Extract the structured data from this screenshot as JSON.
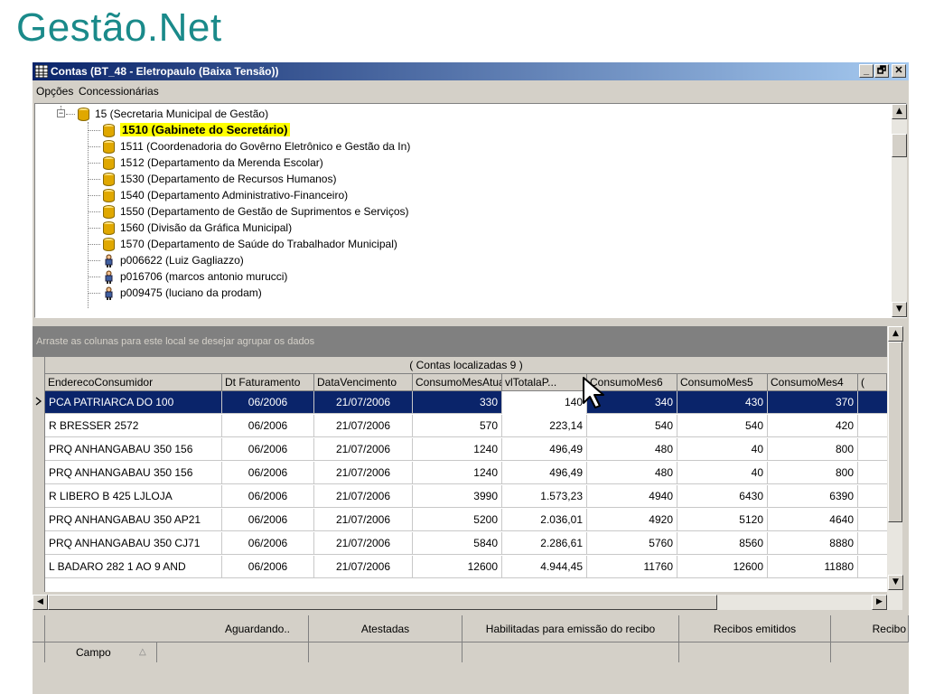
{
  "slide": {
    "title": "Gestão.Net"
  },
  "window": {
    "title": "Contas (BT_48 - Eletropaulo (Baixa Tensão))",
    "buttons": {
      "minimize": "_",
      "maximize": "🗗",
      "close": "✕"
    }
  },
  "menu": {
    "items": [
      "Opções",
      "Concessionárias"
    ]
  },
  "tree": {
    "root": "15 (Secretaria Municipal  de Gestão)",
    "children": [
      {
        "label": "1510 (Gabinete do Secretário)",
        "type": "org",
        "selected": true
      },
      {
        "label": "1511 (Coordenadoria do Govêrno Eletrônico e Gestão da In)",
        "type": "org"
      },
      {
        "label": "1512 (Departamento da Merenda Escolar)",
        "type": "org"
      },
      {
        "label": "1530 (Departamento de Recursos Humanos)",
        "type": "org"
      },
      {
        "label": "1540 (Departamento Administrativo-Financeiro)",
        "type": "org"
      },
      {
        "label": "1550 (Departamento de Gestão de Suprimentos e Serviços)",
        "type": "org"
      },
      {
        "label": "1560 (Divisão da Gráfica Municipal)",
        "type": "org"
      },
      {
        "label": "1570 (Departamento de Saúde do Trabalhador Municipal)",
        "type": "org"
      },
      {
        "label": "p006622 (Luiz Gagliazzo)",
        "type": "person"
      },
      {
        "label": "p016706 (marcos antonio murucci)",
        "type": "person"
      },
      {
        "label": "p009475 (luciano da prodam)",
        "type": "person"
      }
    ]
  },
  "grid": {
    "group_hint": "Arraste as colunas para este local se desejar agrupar os dados",
    "caption": "( Contas localizadas 9 )",
    "columns": [
      "EnderecoConsumidor",
      "Dt Faturamento",
      "DataVencimento",
      "ConsumoMesAtual",
      "vlTotalaP...",
      "ConsumoMes6",
      "ConsumoMes5",
      "ConsumoMes4",
      "("
    ],
    "rows": [
      [
        "PCA PATRIARCA DO 100",
        "06/2006",
        "21/07/2006",
        "330",
        "140",
        "340",
        "430",
        "370"
      ],
      [
        "R BRESSER 2572",
        "06/2006",
        "21/07/2006",
        "570",
        "223,14",
        "540",
        "540",
        "420"
      ],
      [
        "PRQ ANHANGABAU 350 156",
        "06/2006",
        "21/07/2006",
        "1240",
        "496,49",
        "480",
        "40",
        "800"
      ],
      [
        "PRQ ANHANGABAU 350 156",
        "06/2006",
        "21/07/2006",
        "1240",
        "496,49",
        "480",
        "40",
        "800"
      ],
      [
        "R LIBERO B 425 LJLOJA",
        "06/2006",
        "21/07/2006",
        "3990",
        "1.573,23",
        "4940",
        "6430",
        "6390"
      ],
      [
        "PRQ ANHANGABAU 350 AP21",
        "06/2006",
        "21/07/2006",
        "5200",
        "2.036,01",
        "4920",
        "5120",
        "4640"
      ],
      [
        "PRQ ANHANGABAU 350 CJ71",
        "06/2006",
        "21/07/2006",
        "5840",
        "2.286,61",
        "5760",
        "8560",
        "8880"
      ],
      [
        "L BADARO 282 1 AO 9 AND",
        "06/2006",
        "21/07/2006",
        "12600",
        "4.944,45",
        "11760",
        "12600",
        "11880"
      ]
    ],
    "selected_row": 0
  },
  "footer": {
    "columns": [
      "Aguardando..",
      "Atestadas",
      "Habilitadas para emissão do recibo",
      "Recibos emitidos",
      "Recibo"
    ],
    "field_label": "Campo"
  },
  "colors": {
    "accent": "#1a8a8a",
    "titlebar": "#0a246a",
    "selection": "#0a246a",
    "highlight": "#ffff00"
  },
  "icons": {
    "org": "cylinder-db-icon",
    "person": "person-icon",
    "window": "grid-app-icon"
  }
}
